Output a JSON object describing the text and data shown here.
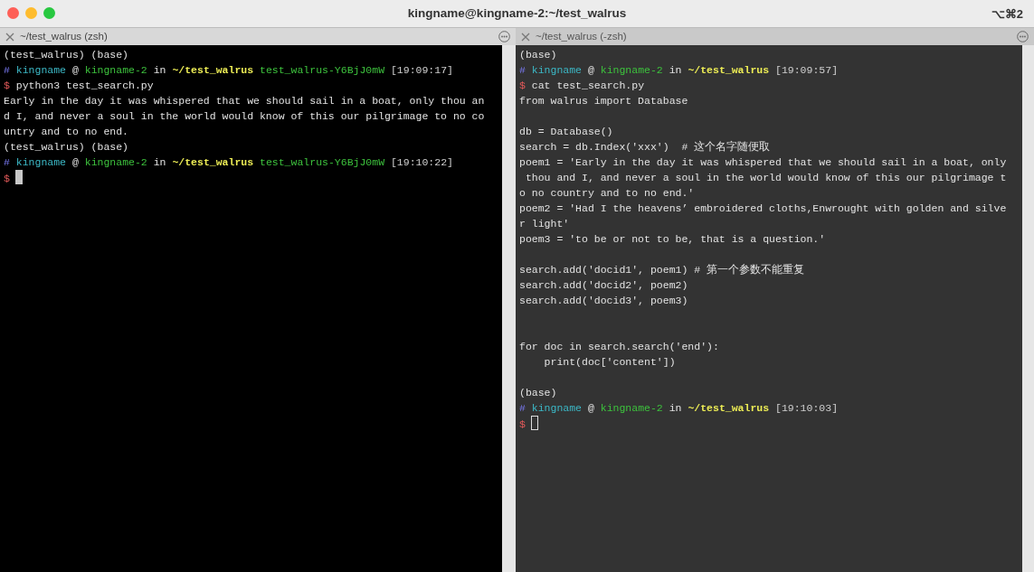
{
  "window": {
    "title": "kingname@kingname-2:~/test_walrus",
    "shortcut": "⌥⌘2"
  },
  "panes": [
    {
      "tab_title": "~/test_walrus (zsh)",
      "selected": true,
      "focused": true,
      "lines": [
        {
          "kind": "text",
          "text": "(test_walrus) (base)"
        },
        {
          "kind": "prompt",
          "hash": "#",
          "user": "kingname",
          "at": "@",
          "host": "kingname-2",
          "in": "in",
          "dir": "~/test_walrus",
          "env": "test_walrus-Y6BjJ0mW",
          "time": "[19:09:17]"
        },
        {
          "kind": "command",
          "sigil": "$",
          "text": "python3 test_search.py"
        },
        {
          "kind": "text",
          "text": "Early in the day it was whispered that we should sail in a boat, only thou an"
        },
        {
          "kind": "text",
          "text": "d I, and never a soul in the world would know of this our pilgrimage to no co"
        },
        {
          "kind": "text",
          "text": "untry and to no end."
        },
        {
          "kind": "text",
          "text": "(test_walrus) (base)"
        },
        {
          "kind": "prompt",
          "hash": "#",
          "user": "kingname",
          "at": "@",
          "host": "kingname-2",
          "in": "in",
          "dir": "~/test_walrus",
          "env": "test_walrus-Y6BjJ0mW",
          "time": "[19:10:22]"
        },
        {
          "kind": "input",
          "sigil": "$"
        }
      ]
    },
    {
      "tab_title": "~/test_walrus (-zsh)",
      "selected": false,
      "focused": false,
      "lines": [
        {
          "kind": "text",
          "text": "(base)"
        },
        {
          "kind": "prompt",
          "hash": "#",
          "user": "kingname",
          "at": "@",
          "host": "kingname-2",
          "in": "in",
          "dir": "~/test_walrus",
          "time": "[19:09:57]"
        },
        {
          "kind": "command",
          "sigil": "$",
          "text": "cat test_search.py"
        },
        {
          "kind": "text",
          "text": "from walrus import Database"
        },
        {
          "kind": "blank"
        },
        {
          "kind": "text",
          "text": "db = Database()"
        },
        {
          "kind": "text",
          "text": "search = db.Index('xxx')  # 这个名字随便取"
        },
        {
          "kind": "text",
          "text": "poem1 = 'Early in the day it was whispered that we should sail in a boat, only"
        },
        {
          "kind": "text",
          "text": " thou and I, and never a soul in the world would know of this our pilgrimage t"
        },
        {
          "kind": "text",
          "text": "o no country and to no end.'"
        },
        {
          "kind": "text",
          "text": "poem2 = 'Had I the heavens’ embroidered cloths,Enwrought with golden and silve"
        },
        {
          "kind": "text",
          "text": "r light'"
        },
        {
          "kind": "text",
          "text": "poem3 = 'to be or not to be, that is a question.'"
        },
        {
          "kind": "blank"
        },
        {
          "kind": "text",
          "text": "search.add('docid1', poem1) # 第一个参数不能重复"
        },
        {
          "kind": "text",
          "text": "search.add('docid2', poem2)"
        },
        {
          "kind": "text",
          "text": "search.add('docid3', poem3)"
        },
        {
          "kind": "blank"
        },
        {
          "kind": "blank"
        },
        {
          "kind": "text",
          "text": "for doc in search.search('end'):"
        },
        {
          "kind": "text",
          "text": "    print(doc['content'])"
        },
        {
          "kind": "blank"
        },
        {
          "kind": "text",
          "text": "(base)"
        },
        {
          "kind": "prompt",
          "hash": "#",
          "user": "kingname",
          "at": "@",
          "host": "kingname-2",
          "in": "in",
          "dir": "~/test_walrus",
          "time": "[19:10:03]"
        },
        {
          "kind": "input",
          "sigil": "$"
        }
      ]
    }
  ]
}
